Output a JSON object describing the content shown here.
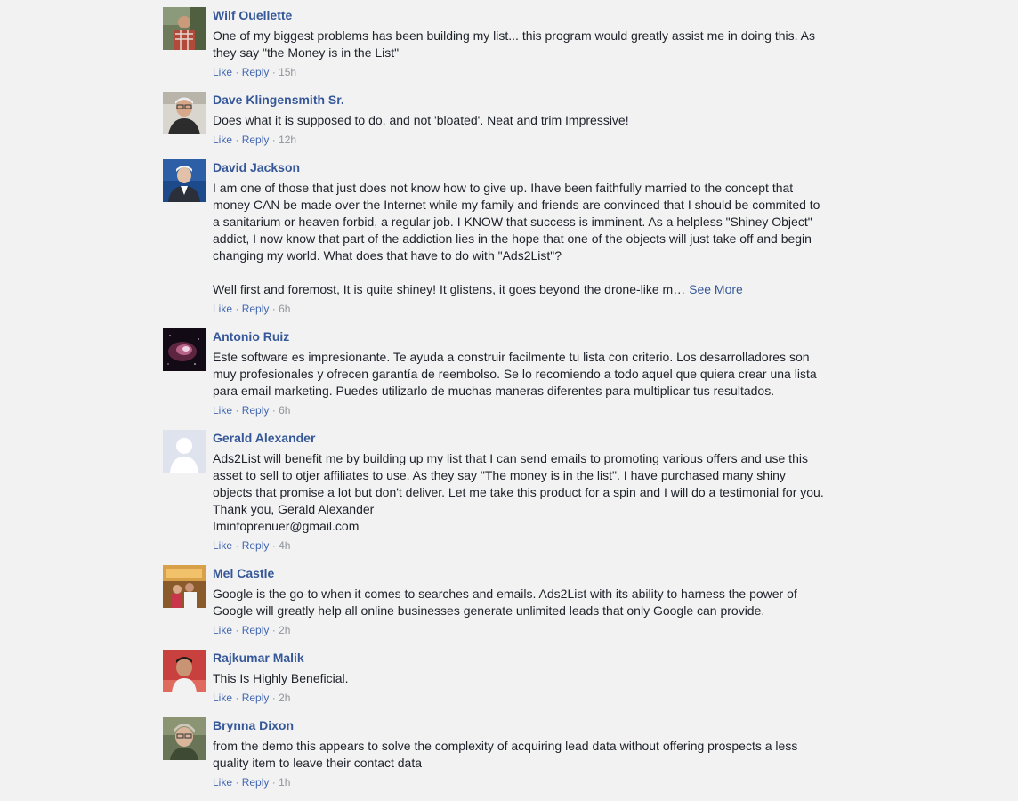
{
  "labels": {
    "like": "Like",
    "reply": "Reply",
    "dot": "·",
    "see_more": "See More"
  },
  "comments": [
    {
      "author": "Wilf Ouellette",
      "text": "One of my biggest problems has been building my list... this program would greatly assist me in doing this. As\nthey say \"the Money is in the List\"",
      "time": "15h",
      "avatar": "photo of man outdoors in plaid shirt"
    },
    {
      "author": "Dave Klingensmith Sr.",
      "text": "Does what it is supposed to do, and not 'bloated'. Neat and trim Impressive!",
      "time": "12h",
      "avatar": "photo of older man with glasses"
    },
    {
      "author": "David Jackson",
      "text": "I am one of those that just does not know how to give up. Ihave been faithfully married to the concept that\nmoney CAN be made over the Internet while my family and friends are convinced that I should be commited to\na sanitarium or heaven forbid, a regular job. I KNOW that success is imminent. As a helpless \"Shiney Object\"\naddict, I now know that part of the addiction lies in the hope that one of the objects will just take off and begin\nchanging my world. What does that have to do with \"Ads2List\"?\n\nWell first and foremost, It is quite shiney! It glistens, it goes beyond the drone-like m… ",
      "see_more": true,
      "time": "6h",
      "avatar": "photo of man in suit on blue background"
    },
    {
      "author": "Antonio Ruiz",
      "text": "Este software es impresionante. Te ayuda a construir facilmente tu lista con criterio. Los desarrolladores son\nmuy profesionales y ofrecen garantía de reembolso. Se lo recomiendo a todo aquel que quiera crear una lista\npara email marketing. Puedes utilizarlo de muchas maneras diferentes para multiplicar tus resultados.",
      "time": "6h",
      "avatar": "nebula image"
    },
    {
      "author": "Gerald Alexander",
      "text": "Ads2List will benefit me by building up my list that I can send emails to promoting various offers and use this\nasset to sell to otjer affiliates to use. As they say \"The money is in the list\". I have purchased many shiny\nobjects that promise a lot but don't deliver. Let me take this product for a spin and I will do a testimonial for you.\nThank you, Gerald Alexander\nIminfoprenuer@gmail.com",
      "time": "4h",
      "avatar": "default silhouette"
    },
    {
      "author": "Mel Castle",
      "text": "Google is the go-to when it comes to searches and emails. Ads2List with its ability to harness the power of\nGoogle will greatly help all online businesses generate unlimited leads that only Google can provide.",
      "time": "2h",
      "avatar": "photo of couple indoors"
    },
    {
      "author": "Rajkumar Malik",
      "text": "This Is Highly Beneficial.",
      "time": "2h",
      "avatar": "photo of man on red background"
    },
    {
      "author": "Brynna Dixon",
      "text": "from the demo this appears to solve the complexity of acquiring lead data without offering prospects a less\nquality item to leave their contact data",
      "time": "1h",
      "avatar": "photo of woman with glasses"
    }
  ]
}
